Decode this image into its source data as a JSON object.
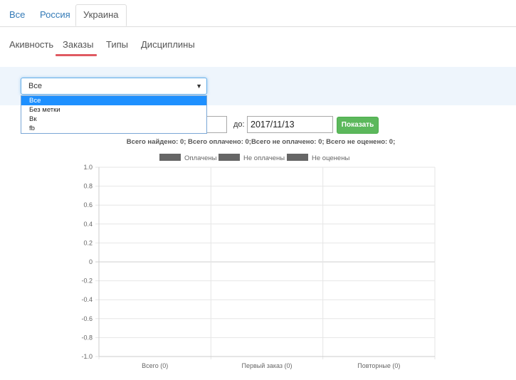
{
  "top_tabs": [
    {
      "label": "Все",
      "active": false
    },
    {
      "label": "Россия",
      "active": false
    },
    {
      "label": "Украина",
      "active": true
    }
  ],
  "sub_tabs": [
    {
      "label": "Акивность",
      "active": false
    },
    {
      "label": "Заказы",
      "active": true
    },
    {
      "label": "Типы",
      "active": false
    },
    {
      "label": "Дисциплины",
      "active": false
    }
  ],
  "filter": {
    "selected": "Все",
    "options": [
      "Все",
      "Без метки",
      "Вк",
      "fb"
    ]
  },
  "date": {
    "to_label": "до:",
    "to_value": "2017/11/13",
    "show_button": "Показать"
  },
  "summary": "Всего найдено: 0; Всего оплачено: 0;Всего не оплачено: 0; Всего не оценено: 0;",
  "colors": {
    "accent_underline": "#e05a62",
    "button_green": "#5cb85c",
    "dropdown_selected": "#1e90ff",
    "legend_series": "#666666"
  },
  "chart_data": {
    "type": "bar",
    "categories": [
      "Всего (0)",
      "Первый заказ (0)",
      "Повторные (0)"
    ],
    "series": [
      {
        "name": "Оплачены",
        "values": [
          0,
          0,
          0
        ]
      },
      {
        "name": "Не оплачены",
        "values": [
          0,
          0,
          0
        ]
      },
      {
        "name": "Не оценены",
        "values": [
          0,
          0,
          0
        ]
      }
    ],
    "ylim": [
      -1.0,
      1.0
    ],
    "yticks": [
      "1.0",
      "0.8",
      "0.6",
      "0.4",
      "0.2",
      "0",
      "-0.2",
      "-0.4",
      "-0.6",
      "-0.8",
      "-1.0"
    ],
    "grid": true,
    "legend": "top"
  }
}
